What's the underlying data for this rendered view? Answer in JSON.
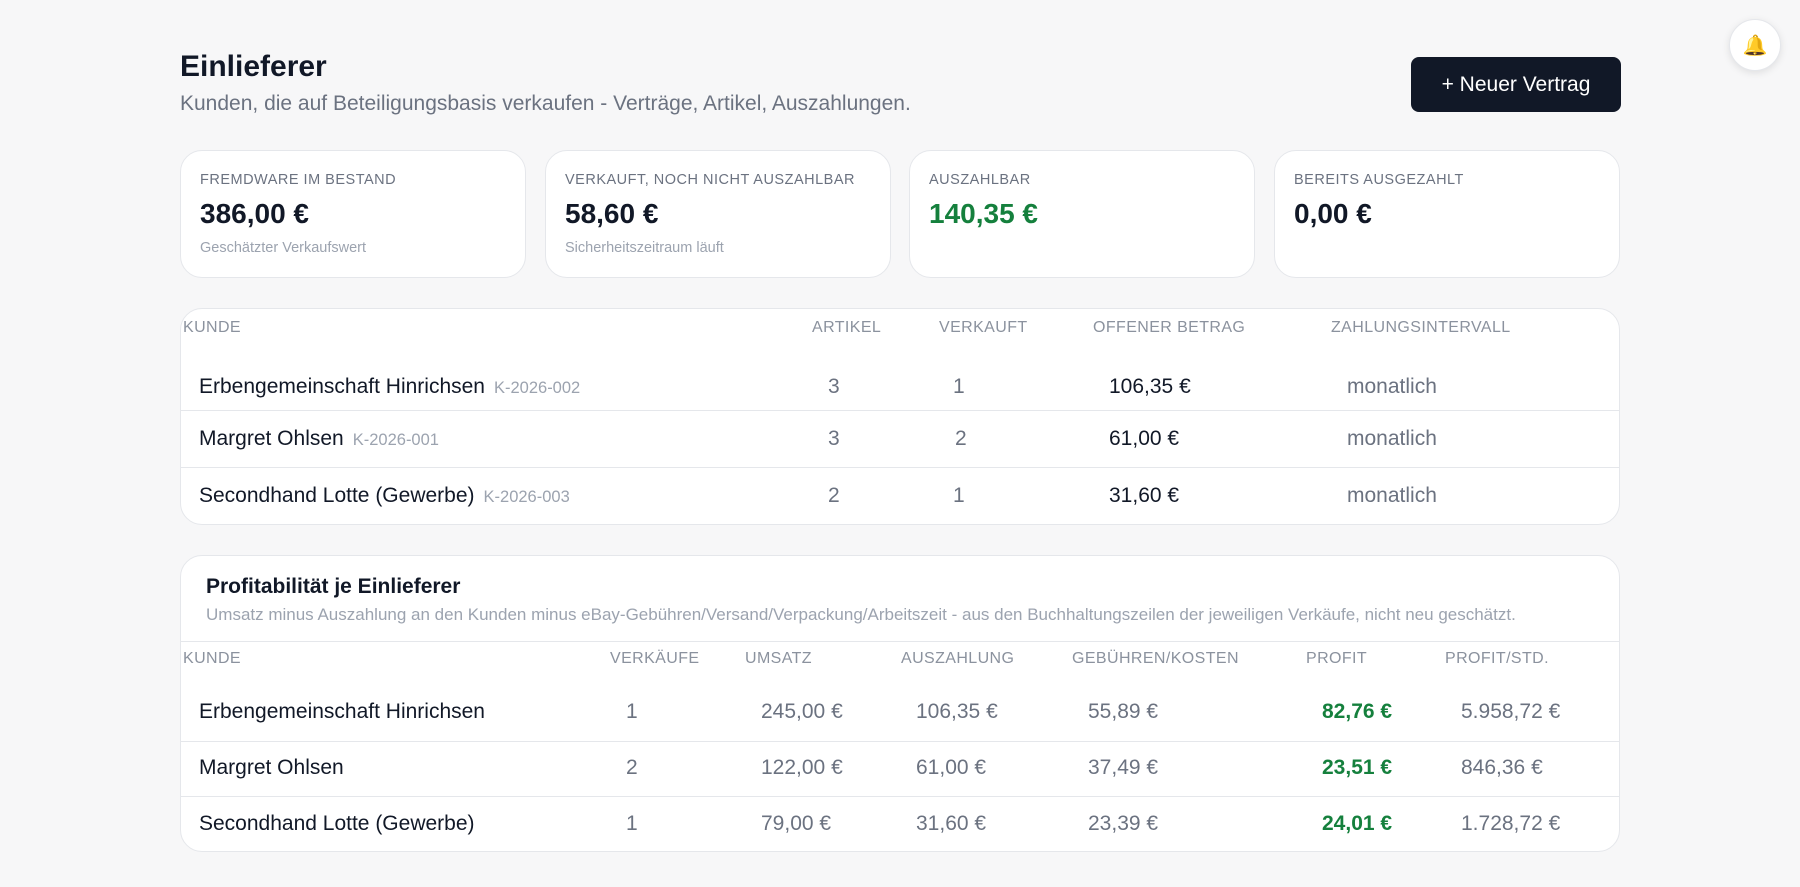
{
  "header": {
    "title": "Einlieferer",
    "subtitle": "Kunden, die auf Beteiligungsbasis verkaufen - Verträge, Artikel, Auszahlungen.",
    "new_button": "+ Neuer Vertrag"
  },
  "notification_icon": "bell-icon",
  "stats": [
    {
      "label": "FREMDWARE IM BESTAND",
      "value": "386,00 €",
      "note": "Geschätzter Verkaufswert"
    },
    {
      "label": "VERKAUFT, NOCH NICHT AUSZAHLBAR",
      "value": "58,60 €",
      "note": "Sicherheitszeitraum läuft"
    },
    {
      "label": "AUSZAHLBAR",
      "value": "140,35 €",
      "note": ""
    },
    {
      "label": "BEREITS AUSGEZAHLT",
      "value": "0,00 €",
      "note": ""
    }
  ],
  "colors": {
    "accent_green": "#15803d",
    "button_dark": "#111827"
  },
  "customers_table": {
    "headers": {
      "kunde": "KUNDE",
      "artikel": "ARTIKEL",
      "verkauft": "VERKAUFT",
      "offen": "OFFENER BETRAG",
      "intervall": "ZAHLUNGSINTERVALL"
    },
    "rows": [
      {
        "name": "Erbengemeinschaft Hinrichsen",
        "code": "K-2026-002",
        "artikel": "3",
        "verkauft": "1",
        "offen": "106,35 €",
        "intervall": "monatlich"
      },
      {
        "name": "Margret Ohlsen",
        "code": "K-2026-001",
        "artikel": "3",
        "verkauft": "2",
        "offen": "61,00 €",
        "intervall": "monatlich"
      },
      {
        "name": "Secondhand Lotte (Gewerbe)",
        "code": "K-2026-003",
        "artikel": "2",
        "verkauft": "1",
        "offen": "31,60 €",
        "intervall": "monatlich"
      }
    ]
  },
  "profit": {
    "title": "Profitabilität je Einlieferer",
    "subtitle": "Umsatz minus Auszahlung an den Kunden minus eBay-Gebühren/Versand/Verpackung/Arbeitszeit - aus den Buchhaltungszeilen der jeweiligen Verkäufe, nicht neu geschätzt.",
    "headers": {
      "kunde": "KUNDE",
      "verkaeufe": "VERKÄUFE",
      "umsatz": "UMSATZ",
      "auszahlung": "AUSZAHLUNG",
      "gebuehren": "GEBÜHREN/KOSTEN",
      "profit": "PROFIT",
      "profit_std": "PROFIT/STD."
    },
    "rows": [
      {
        "name": "Erbengemeinschaft Hinrichsen",
        "verkaeufe": "1",
        "umsatz": "245,00 €",
        "auszahlung": "106,35 €",
        "gebuehren": "55,89 €",
        "profit": "82,76 €",
        "profit_std": "5.958,72 €"
      },
      {
        "name": "Margret Ohlsen",
        "verkaeufe": "2",
        "umsatz": "122,00 €",
        "auszahlung": "61,00 €",
        "gebuehren": "37,49 €",
        "profit": "23,51 €",
        "profit_std": "846,36 €"
      },
      {
        "name": "Secondhand Lotte (Gewerbe)",
        "verkaeufe": "1",
        "umsatz": "79,00 €",
        "auszahlung": "31,60 €",
        "gebuehren": "23,39 €",
        "profit": "24,01 €",
        "profit_std": "1.728,72 €"
      }
    ]
  }
}
